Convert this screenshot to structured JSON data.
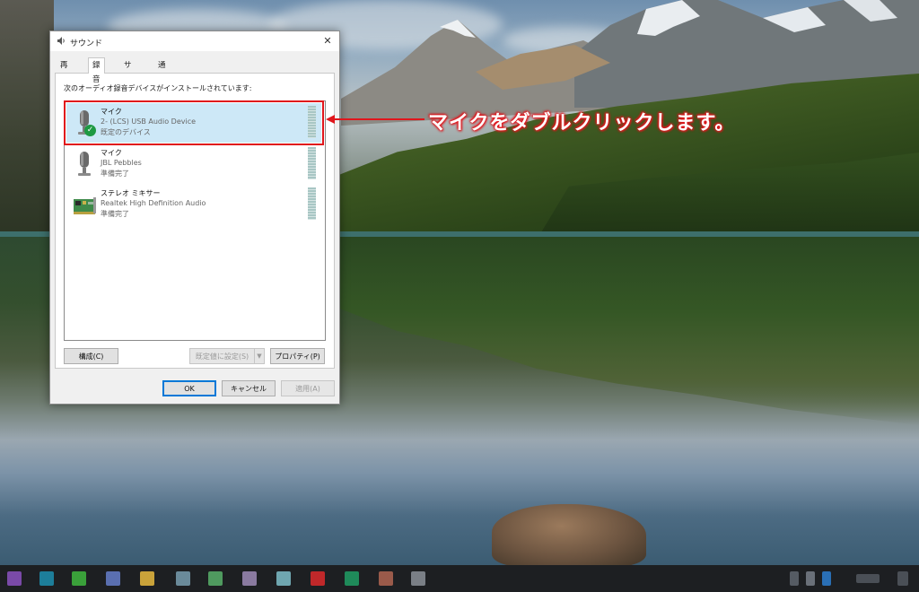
{
  "dialog": {
    "title": "サウンド",
    "close_glyph": "✕",
    "tabs": [
      {
        "label": "再生",
        "active": false
      },
      {
        "label": "録音",
        "active": true
      },
      {
        "label": "サウンド",
        "active": false
      },
      {
        "label": "通信",
        "active": false
      }
    ],
    "instruction": "次のオーディオ録音デバイスがインストールされています:",
    "devices": [
      {
        "name": "マイク",
        "description": "2- (LCS) USB Audio Device",
        "status": "既定のデバイス",
        "icon": "microphone-icon",
        "default": true
      },
      {
        "name": "マイク",
        "description": "JBL Pebbles",
        "status": "準備完了",
        "icon": "microphone-icon",
        "default": false
      },
      {
        "name": "ステレオ ミキサー",
        "description": "Realtek High Definition Audio",
        "status": "準備完了",
        "icon": "sound-card-icon",
        "default": false
      }
    ],
    "buttons": {
      "configure": "構成(C)",
      "set_default": "既定値に設定(S)",
      "properties": "プロパティ(P)",
      "ok": "OK",
      "cancel": "キャンセル",
      "apply": "適用(A)"
    }
  },
  "annotation": {
    "text": "マイクをダブルクリックします。",
    "color": "#e0161c"
  },
  "colors": {
    "selection": "#cde8f7",
    "highlight_border": "#e0161c",
    "default_check": "#1e9a43"
  }
}
